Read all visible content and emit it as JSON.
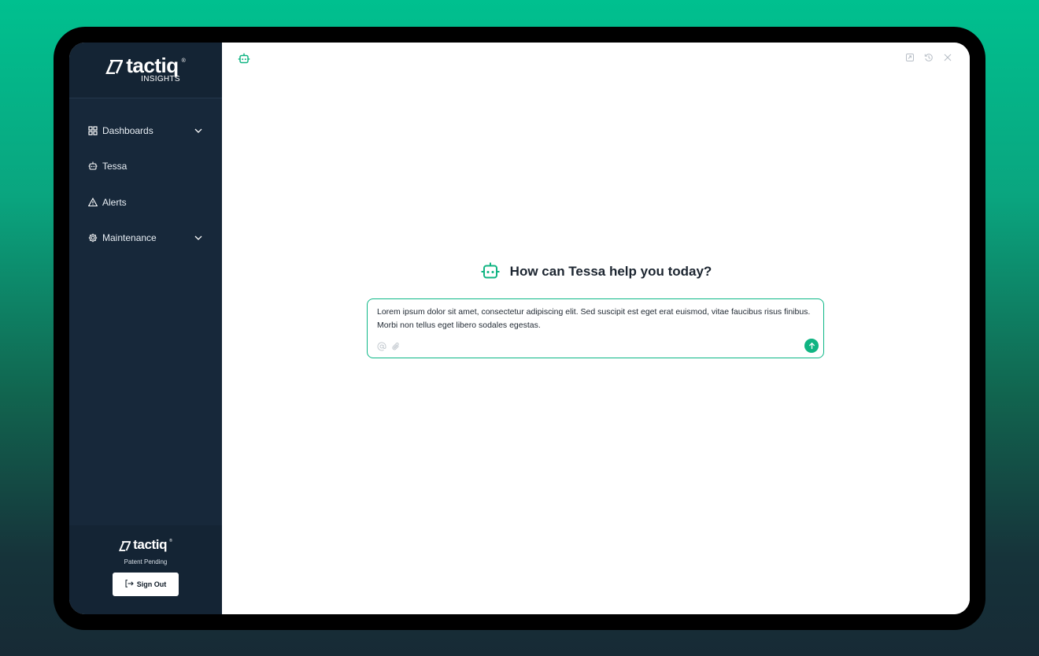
{
  "brand": {
    "name": "tactiq",
    "sub": "INSIGHTS",
    "reg": "®"
  },
  "sidebar": {
    "items": [
      {
        "label": "Dashboards",
        "icon": "grid-icon",
        "has_chevron": true
      },
      {
        "label": "Tessa",
        "icon": "robot-icon",
        "has_chevron": false
      },
      {
        "label": "Alerts",
        "icon": "alert-triangle-icon",
        "has_chevron": false
      },
      {
        "label": "Maintenance",
        "icon": "gear-icon",
        "has_chevron": true
      }
    ],
    "footer": {
      "logo": "tactiq",
      "reg": "®",
      "patent": "Patent Pending",
      "signout": "Sign Out"
    }
  },
  "main": {
    "heading": "How can Tessa help you today?",
    "composer": {
      "value": "Lorem ipsum dolor sit amet, consectetur adipiscing elit. Sed suscipit est eget erat euismod, vitae faucibus risus finibus. Morbi non tellus eget libero sodales egestas."
    },
    "window_controls": [
      "expand-icon",
      "history-icon",
      "close-icon"
    ]
  },
  "colors": {
    "accent": "#10b482",
    "sidebar": "#17283a",
    "background_top": "#00c08f",
    "background_bottom": "#172a35"
  }
}
